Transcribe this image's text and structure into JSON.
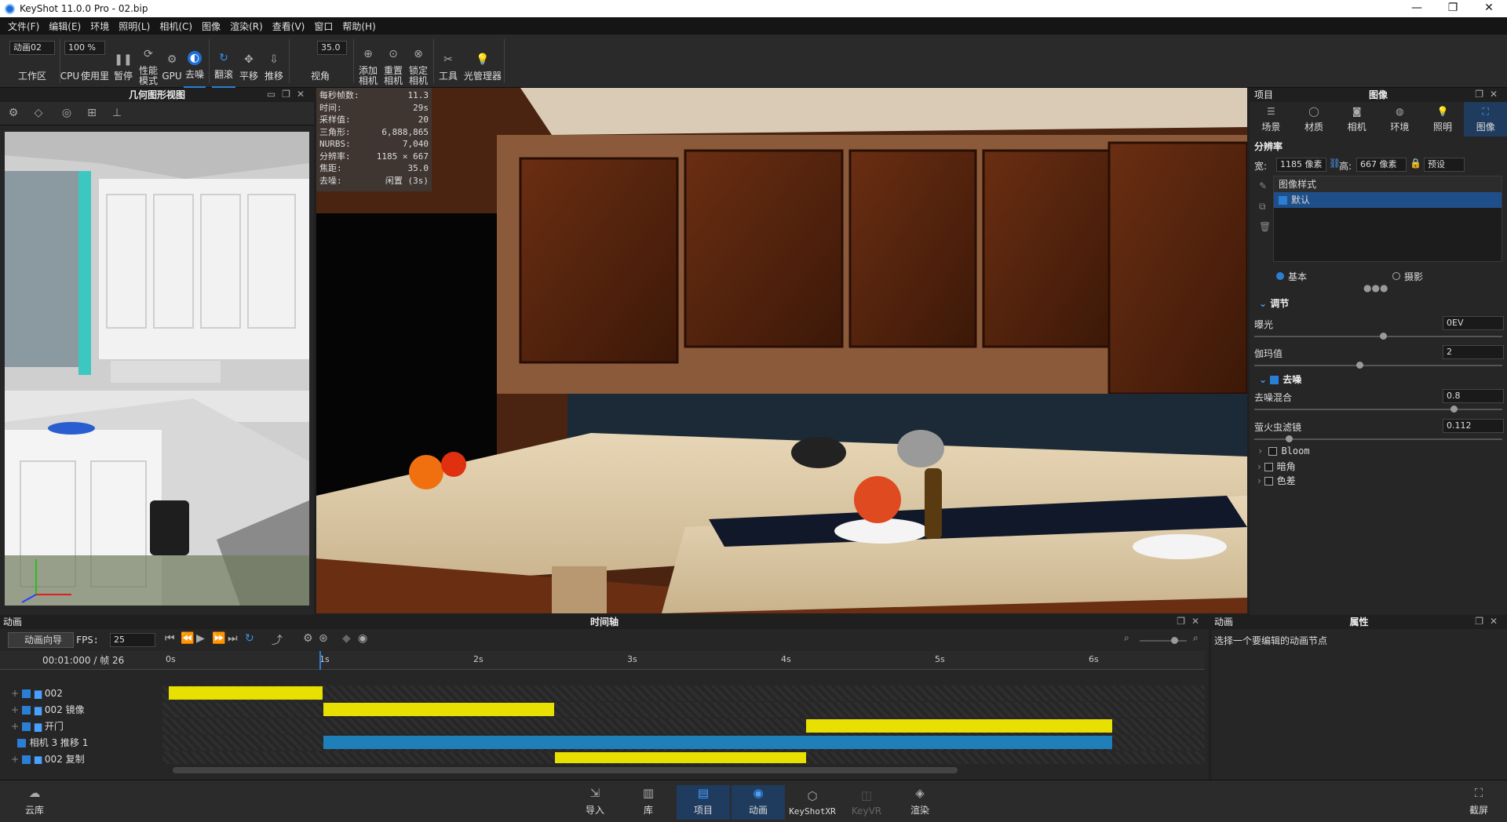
{
  "window": {
    "title": "KeyShot 11.0.0 Pro  - 02.bip",
    "minimize": "—",
    "maximize": "❐",
    "close": "✕"
  },
  "menu": [
    "文件(F)",
    "编辑(E)",
    "环境",
    "照明(L)",
    "相机(C)",
    "图像",
    "渲染(R)",
    "查看(V)",
    "窗口",
    "帮助(H)"
  ],
  "toolbar": {
    "animation_select": "动画02",
    "zoom_value": "100 %",
    "workspace": "工作区",
    "cpu": "CPU",
    "usage": "使用里",
    "pause": "暂停",
    "perf_mode": "性能\n模式",
    "gpu": "GPU",
    "denoise": "去噪",
    "tumble": "翻滚",
    "pan": "平移",
    "dolly": "推移",
    "fov_value": "35.0",
    "view_angle": "视角",
    "add_camera": "添加\n相机",
    "reset_camera": "重置\n相机",
    "lock_camera": "锁定\n相机",
    "tools": "工具",
    "light_manager": "光管理器"
  },
  "geometry_view": {
    "title": "几何图形视图"
  },
  "stats": [
    {
      "k": "每秒帧数:",
      "v": "11.3"
    },
    {
      "k": "时间:",
      "v": "29s"
    },
    {
      "k": "采样值:",
      "v": "20"
    },
    {
      "k": "三角形:",
      "v": "6,888,865"
    },
    {
      "k": "NURBS:",
      "v": "7,040"
    },
    {
      "k": "分辨率:",
      "v": "1185 × 667"
    },
    {
      "k": "焦距:",
      "v": "35.0"
    },
    {
      "k": "去噪:",
      "v": "闲置 (3s)"
    }
  ],
  "project": {
    "left_title": "项目",
    "title": "图像",
    "tabs": [
      "场景",
      "材质",
      "相机",
      "环境",
      "照明",
      "图像"
    ],
    "resolution_label": "分辨率",
    "width_label": "宽:",
    "width_value": "1185 像素",
    "height_label": "高:",
    "height_value": "667 像素",
    "preset": "预设",
    "style_header": "图像样式",
    "style_item": "默认",
    "mode_basic": "基本",
    "mode_photo": "摄影",
    "adjust_header": "调节",
    "exposure_label": "曝光",
    "exposure_value": "0EV",
    "gamma_label": "伽玛值",
    "gamma_value": "2",
    "denoise_header": "去噪",
    "denoise_mix_label": "去噪混合",
    "denoise_mix_value": "0.8",
    "firefly_label": "萤火虫滤镜",
    "firefly_value": "0.112",
    "effects": [
      "Bloom",
      "暗角",
      "色差"
    ]
  },
  "timeline": {
    "left_title": "动画",
    "title": "时间轴",
    "wizard": "动画向导",
    "fps_label": "FPS:",
    "fps_value": "25",
    "timecode": "00:01:000 / 帧 26",
    "ticks": [
      "0s",
      "1s",
      "2s",
      "3s",
      "4s",
      "5s",
      "6s"
    ],
    "tracks": [
      "002",
      "002 镜像",
      "开门",
      "相机 3 推移 1",
      "002 复制"
    ]
  },
  "properties": {
    "left_title": "动画",
    "title": "属性",
    "hint": "选择一个要编辑的动画节点"
  },
  "bottombar": {
    "cloud": "云库",
    "items": [
      "导入",
      "库",
      "项目",
      "动画",
      "KeyShotXR",
      "KeyVR",
      "渲染"
    ],
    "screenshot": "截屏"
  }
}
